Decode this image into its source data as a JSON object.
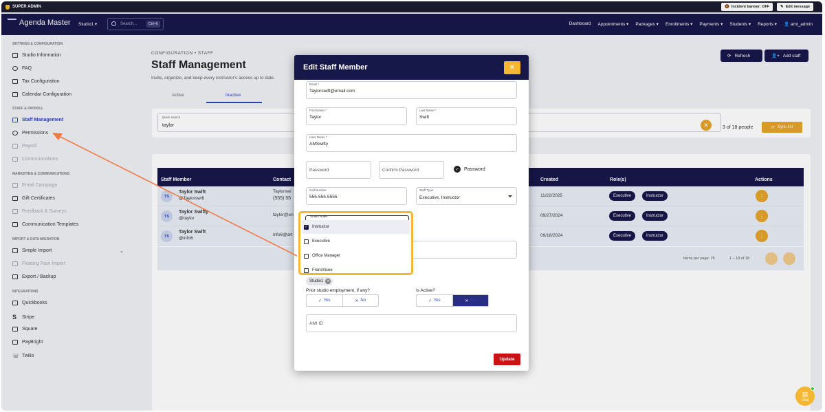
{
  "topbar": {
    "super_admin": "SUPER ADMIN",
    "incident_banner": "Incident banner: OFF",
    "edit_message": "Edit message"
  },
  "nav": {
    "brand": "Agenda Master",
    "studio": "Studio1",
    "search_placeholder": "Search...",
    "search_kbd": "Ctrl+K",
    "items": [
      "Dashboard",
      "Appointments",
      "Packages",
      "Enrollments",
      "Payments",
      "Students",
      "Reports",
      "amt_admin"
    ]
  },
  "sidebar": {
    "sec1": "SETTINGS & CONFIGURATION",
    "studio_information": "Studio Information",
    "faq": "FAQ",
    "tax_configuration": "Tax Configuration",
    "calendar_configuration": "Calendar Configuration",
    "sec2": "STAFF & PAYROLL",
    "staff_management": "Staff Management",
    "permissions": "Permissions",
    "payroll": "Payroll",
    "communications": "Communications",
    "sec3": "MARKETING & COMMUNICATIONS",
    "email_campaign": "Email Campaign",
    "gift_certificates": "Gift Certificates",
    "feedback_surveys": "Feedback & Surveys",
    "communication_templates": "Communication Templates",
    "sec4": "IMPORT & DATA MIGRATION",
    "simple_import": "Simple Import",
    "floating_rain_import": "Floating Rain Import",
    "export_backup": "Export / Backup",
    "sec5": "INTEGRATIONS",
    "quickbooks": "Quickbooks",
    "stripe": "Stripe",
    "square": "Square",
    "paybright": "PayBright",
    "twilio": "Twilio"
  },
  "main": {
    "breadcrumb": "CONFIGURATION • STAFF",
    "title": "Staff Management",
    "subtitle": "Invite, organize, and keep every instructor's access up to date.",
    "tab_active": "Active",
    "tab_inactive": "Inactive",
    "refresh": "Refresh",
    "add_staff": "Add staff",
    "quick_search_label": "Quick search",
    "quick_search_value": "taylor",
    "count": "3 of 18 people",
    "sync_list": "Sync list"
  },
  "table": {
    "headers": {
      "member": "Staff Member",
      "contact": "Contact",
      "created": "Created",
      "roles": "Role(s)",
      "actions": "Actions"
    },
    "rows": [
      {
        "initials": "TS",
        "name": "Taylor Swift",
        "handle": "@Taylorswift",
        "contact": "Taylorswi",
        "contact2": "(555) 55",
        "created": "11/22/2025",
        "roles": [
          "Executive",
          "Instructor"
        ]
      },
      {
        "initials": "TS",
        "name": "Taylor Swifty",
        "handle": "@taylor",
        "contact": "taylor@en",
        "contact2": "",
        "created": "09/27/2024",
        "roles": [
          "Executive",
          "Instructor"
        ]
      },
      {
        "initials": "TS",
        "name": "Taylor Swift",
        "handle": "@info6",
        "contact": "info6@art",
        "contact2": "",
        "created": "09/18/2024",
        "roles": [
          "Executive",
          "Instructor"
        ]
      }
    ],
    "items_per_page": "Items per page: 25",
    "range": "1 – 18 of 18"
  },
  "modal": {
    "title": "Edit Staff Member",
    "close": "✕",
    "email_label": "Email *",
    "email_value": "Taylorswift@email.com",
    "first_name_label": "First Name *",
    "first_name_value": "Taylor",
    "last_name_label": "Last Name *",
    "last_name_value": "Swift",
    "user_name_label": "User Name *",
    "user_name_value": "AMSwifty",
    "password_placeholder": "Password",
    "confirm_password_placeholder": "Confirm Password",
    "password_check_label": "Password",
    "cell_label": "Cell Number",
    "cell_value": "555-555-5555",
    "staff_type_label": "Staff Type",
    "staff_type_value": "Executive, Instructor",
    "studio_roles_label": "Studio Roles",
    "roles": [
      {
        "label": "Instructor",
        "checked": true
      },
      {
        "label": "Executive",
        "checked": false
      },
      {
        "label": "Office Manager",
        "checked": false
      },
      {
        "label": "Franchisee",
        "checked": false
      }
    ],
    "chip": "Studio1",
    "prior_label": "Prior studio employment, if any?",
    "is_active_label": "Is Active?",
    "yes": "Yes",
    "no": "No",
    "ami_id_placeholder": "AMI ID",
    "update": "Update"
  },
  "chat": {
    "label": "Chat"
  },
  "colors": {
    "navy": "#17184a",
    "accent": "#f5b731",
    "blue": "#2a46b8",
    "danger": "#cc1111",
    "annotation": "#f07a45"
  }
}
